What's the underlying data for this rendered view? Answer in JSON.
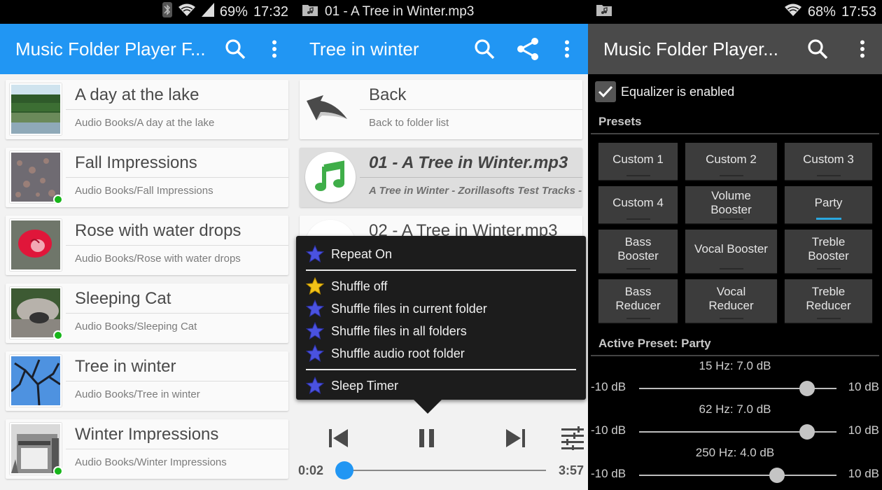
{
  "screens": [
    {
      "status": {
        "battery": "69%",
        "time": "17:32",
        "icons": [
          "bluetooth-icon",
          "wifi-icon",
          "signal-icon"
        ]
      },
      "appbar": {
        "title": "Music Folder Player F...",
        "actions": [
          "search-icon",
          "overflow-menu-icon"
        ]
      },
      "folders": [
        {
          "title": "A day at the lake",
          "path": "Audio Books/A day at the lake",
          "thumb": "lake",
          "has_badge": false
        },
        {
          "title": "Fall Impressions",
          "path": "Audio Books/Fall Impressions",
          "thumb": "leaves",
          "has_badge": true
        },
        {
          "title": "Rose with water drops",
          "path": "Audio Books/Rose with water drops",
          "thumb": "rose",
          "has_badge": false
        },
        {
          "title": "Sleeping Cat",
          "path": "Audio Books/Sleeping Cat",
          "thumb": "cat",
          "has_badge": true
        },
        {
          "title": "Tree in winter",
          "path": "Audio Books/Tree in winter",
          "thumb": "tree",
          "has_badge": false
        },
        {
          "title": "Winter Impressions",
          "path": "Audio Books/Winter Impressions",
          "thumb": "building",
          "has_badge": true
        }
      ]
    },
    {
      "status": {
        "notification": "01 - A Tree in Winter.mp3",
        "icons": [
          "music-folder-icon"
        ]
      },
      "appbar": {
        "title": "Tree in winter",
        "actions": [
          "search-icon",
          "share-icon",
          "overflow-menu-icon"
        ]
      },
      "back": {
        "title": "Back",
        "subtitle": "Back to folder list"
      },
      "tracks": [
        {
          "title": "01 - A Tree in Winter.mp3",
          "subtitle": "A Tree in Winter - Zorillasofts Test Tracks -",
          "selected": true
        },
        {
          "title": "02 - A Tree in Winter.mp3",
          "subtitle": "",
          "selected": false
        }
      ],
      "popup_menu": {
        "groups": [
          [
            {
              "label": "Repeat On",
              "star": "blue"
            }
          ],
          [
            {
              "label": "Shuffle off",
              "star": "gold"
            },
            {
              "label": "Shuffle files in current folder",
              "star": "blue"
            },
            {
              "label": "Shuffle files in all folders",
              "star": "blue"
            },
            {
              "label": "Shuffle audio root folder",
              "star": "blue"
            }
          ],
          [
            {
              "label": "Sleep Timer",
              "star": "blue"
            }
          ]
        ]
      },
      "player": {
        "elapsed": "0:02",
        "duration": "3:57",
        "progress_fraction": 0.008,
        "state": "playing",
        "controls": [
          "previous-icon",
          "pause-icon",
          "next-icon",
          "equalizer-icon"
        ]
      }
    },
    {
      "status": {
        "battery": "68%",
        "time": "17:53",
        "icons": [
          "music-folder-icon",
          "wifi-icon"
        ]
      },
      "appbar": {
        "title": "Music Folder Player...",
        "actions": [
          "search-icon",
          "overflow-menu-icon"
        ]
      },
      "equalizer": {
        "enabled_label": "Equalizer is enabled",
        "enabled": true,
        "presets_heading": "Presets",
        "presets": [
          {
            "label": "Custom 1",
            "active": false
          },
          {
            "label": "Custom 2",
            "active": false
          },
          {
            "label": "Custom 3",
            "active": false
          },
          {
            "label": "Custom 4",
            "active": false
          },
          {
            "label": "Volume\nBooster",
            "active": false
          },
          {
            "label": "Party",
            "active": true
          },
          {
            "label": "Bass\nBooster",
            "active": false
          },
          {
            "label": "Vocal Booster",
            "active": false
          },
          {
            "label": "Treble\nBooster",
            "active": false
          },
          {
            "label": "Bass\nReducer",
            "active": false
          },
          {
            "label": "Vocal\nReducer",
            "active": false
          },
          {
            "label": "Treble\nReducer",
            "active": false
          }
        ],
        "active_preset_label": "Active Preset: Party",
        "range": {
          "min": -10,
          "max": 10,
          "min_label": "-10 dB",
          "max_label": "10 dB"
        },
        "bands": [
          {
            "label": "15 Hz: 7.0 dB",
            "value": 7.0
          },
          {
            "label": "62 Hz: 7.0 dB",
            "value": 7.0
          },
          {
            "label": "250 Hz: 4.0 dB",
            "value": 4.0
          }
        ]
      }
    }
  ],
  "colors": {
    "accent": "#2196f3",
    "dark_appbar": "#4a4a4a",
    "active_preset": "#2aa8e0",
    "badge": "#17b51a"
  }
}
